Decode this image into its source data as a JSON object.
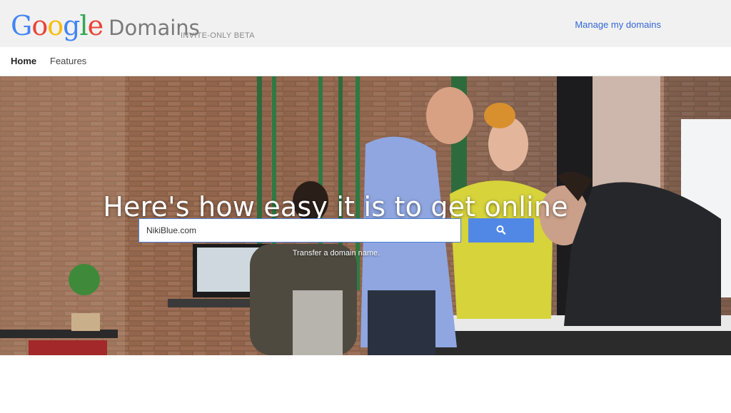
{
  "header": {
    "logo_letters": [
      {
        "char": "G",
        "color": "#4285f4"
      },
      {
        "char": "o",
        "color": "#ea4335"
      },
      {
        "char": "o",
        "color": "#fbbc05"
      },
      {
        "char": "g",
        "color": "#4285f4"
      },
      {
        "char": "l",
        "color": "#34a853"
      },
      {
        "char": "e",
        "color": "#ea4335"
      }
    ],
    "product_name": "Domains",
    "badge": "INVITE-ONLY BETA",
    "manage_link": "Manage my domains"
  },
  "nav": {
    "items": [
      {
        "label": "Home",
        "active": true
      },
      {
        "label": "Features",
        "active": false
      }
    ]
  },
  "hero": {
    "headline": "Here's how easy it is to get online",
    "search": {
      "value": "NikiBlue.com",
      "button_icon": "search-icon"
    },
    "transfer_link": "Transfer a domain name."
  },
  "colors": {
    "accent_blue": "#5188e6",
    "link_blue": "#3367d6",
    "topbar_bg": "#f1f1f1"
  }
}
